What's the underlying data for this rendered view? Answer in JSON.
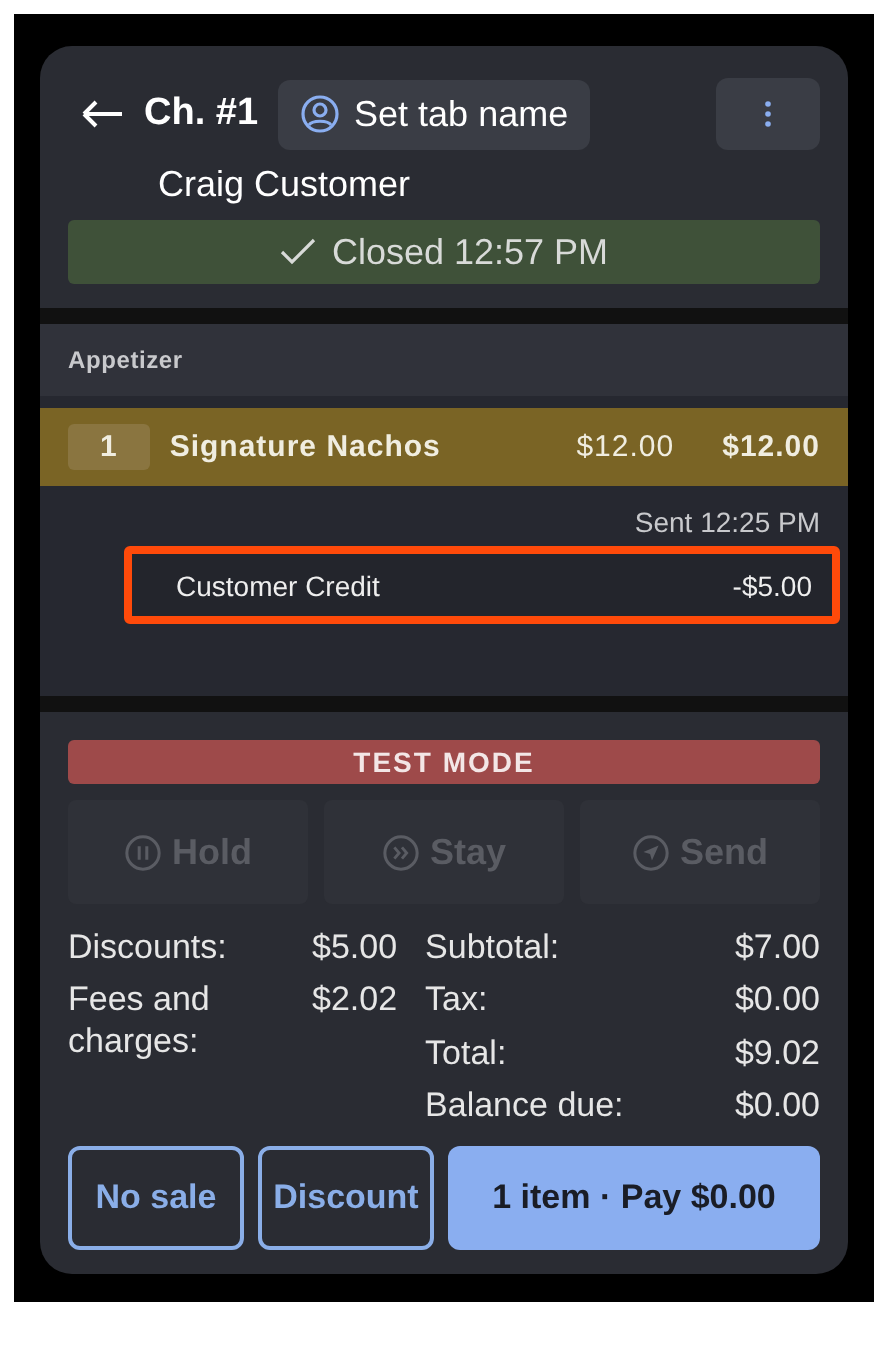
{
  "header": {
    "check": "Ch. #1",
    "tab_name_button": "Set tab name",
    "customer": "Craig Customer",
    "status": "Closed 12:57 PM"
  },
  "order": {
    "category": "Appetizer",
    "items": [
      {
        "qty": "1",
        "name": "Signature Nachos",
        "price": "$12.00",
        "total": "$12.00",
        "selected": true,
        "sent": "Sent 12:25 PM",
        "modifiers": [
          {
            "name": "Customer Credit",
            "amount": "-$5.00",
            "highlighted": true
          }
        ]
      }
    ]
  },
  "test_mode": "TEST MODE",
  "actions": [
    {
      "label": "Hold",
      "disabled": true
    },
    {
      "label": "Stay",
      "disabled": true
    },
    {
      "label": "Send",
      "disabled": true
    }
  ],
  "summary_left": [
    {
      "label": "Fees and charges:",
      "value": "$2.02"
    }
  ],
  "summary_left_first": {
    "label": "Discounts:",
    "value": "$5.00"
  },
  "summary_right": [
    {
      "label": "Subtotal:",
      "value": "$7.00"
    },
    {
      "label": "Tax:",
      "value": "$0.00"
    },
    {
      "label": "Total:",
      "value": "$9.02"
    },
    {
      "label": "Balance due:",
      "value": "$0.00"
    }
  ],
  "buttons": [
    {
      "label": "No sale",
      "kind": "outline"
    },
    {
      "label": "Discount",
      "kind": "outline"
    },
    {
      "label": "1 item · Pay $0.00",
      "kind": "primary"
    }
  ]
}
